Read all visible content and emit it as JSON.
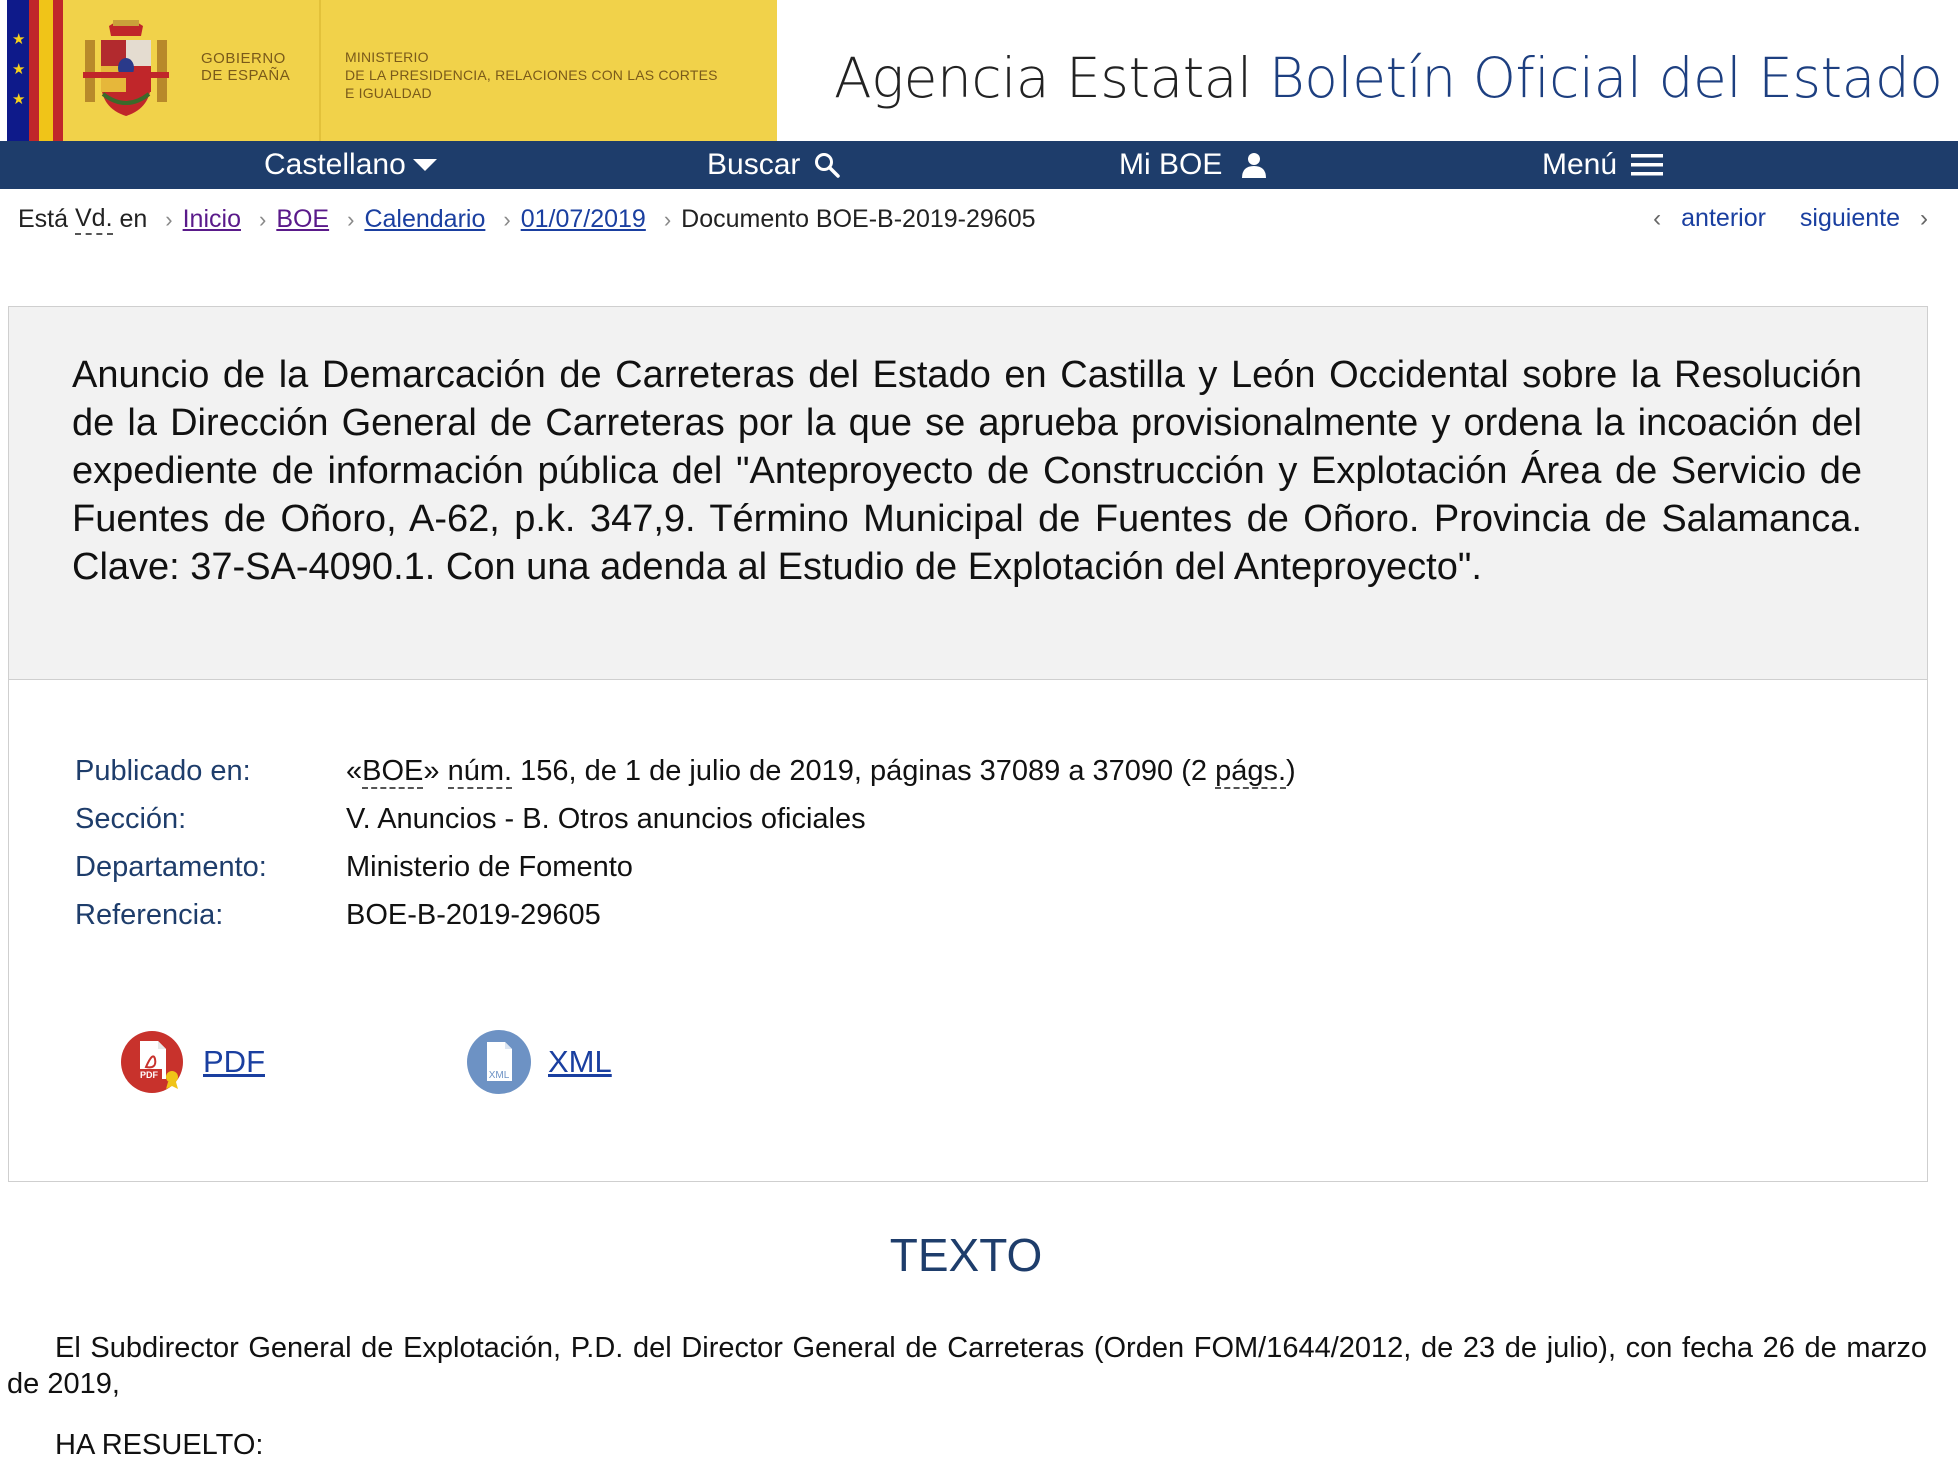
{
  "header": {
    "gov_line1": "GOBIERNO",
    "gov_line2": "DE ESPAÑA",
    "ministry_line1": "MINISTERIO",
    "ministry_line2": "DE LA PRESIDENCIA, RELACIONES CON LAS CORTES",
    "ministry_line3": "E IGUALDAD",
    "title_prefix": "Agencia Estatal",
    "title_accent": "Boletín Oficial del Estado"
  },
  "nav": {
    "language": "Castellano",
    "search": "Buscar",
    "my_boe": "Mi BOE",
    "menu": "Menú"
  },
  "breadcrumb": {
    "intro_a": "Está",
    "intro_abbr": "Vd.",
    "intro_b": "en",
    "items": [
      "Inicio",
      "BOE",
      "Calendario",
      "01/07/2019"
    ],
    "current": "Documento BOE-B-2019-29605"
  },
  "pager": {
    "prev": "anterior",
    "next": "siguiente"
  },
  "document": {
    "title": "Anuncio de la Demarcación de Carreteras del Estado en Castilla y León Occidental sobre la Resolución de la Dirección General de Carreteras por la que se aprueba provisionalmente y ordena la incoación del expediente de información pública del \"Anteproyecto de Construcción y Explotación Área de Servicio de Fuentes de Oñoro, A-62, p.k. 347,9. Término Municipal de Fuentes de Oñoro. Provincia de Salamanca. Clave: 37-SA-4090.1. Con una adenda al Estudio de Explotación del Anteproyecto\".",
    "published_label": "Publicado en:",
    "published_pre": "«",
    "published_boe": "BOE",
    "published_mid": "» ",
    "published_num": "núm.",
    "published_rest": " 156, de 1 de julio de 2019, páginas 37089 a 37090 (2 ",
    "published_pags": "págs.",
    "published_end": ")",
    "section_label": "Sección:",
    "section_value": "V. Anuncios - B. Otros anuncios oficiales",
    "department_label": "Departamento:",
    "department_value": "Ministerio de Fomento",
    "reference_label": "Referencia:",
    "reference_value": "BOE-B-2019-29605",
    "pdf_label": "PDF",
    "xml_label": "XML"
  },
  "body": {
    "heading": "TEXTO",
    "para1": "El Subdirector General de Explotación, P.D. del Director General de Carreteras (Orden FOM/1644/2012, de 23 de julio), con fecha 26 de marzo de 2019,",
    "para2": "HA RESUELTO:"
  },
  "colors": {
    "nav_bg": "#1e3d6b",
    "gov_yellow": "#f1d24a",
    "accent_blue": "#1d3f80",
    "link_blue": "#1a3fa0",
    "visited_purple": "#5a1a8a"
  },
  "icons": {
    "search": "search-icon",
    "user": "user-icon",
    "menu": "hamburger-icon",
    "language": "chevron-down-icon",
    "pdf": "pdf-file-icon",
    "xml": "xml-file-icon"
  }
}
